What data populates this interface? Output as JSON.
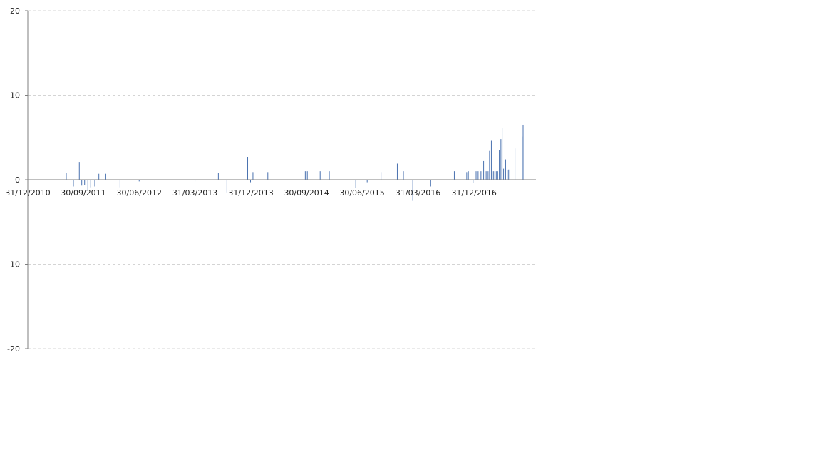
{
  "chart_data": {
    "type": "bar",
    "title": "",
    "xlabel": "",
    "ylabel": "",
    "ylim": [
      -20,
      20
    ],
    "xlim": [
      "2010-12-31",
      "2017-10-31"
    ],
    "grid": true,
    "yticks": [
      20,
      10,
      0,
      -10,
      -20
    ],
    "xticks": [
      {
        "label": "31/12/2010",
        "date": "2010-12-31"
      },
      {
        "label": "30/09/2011",
        "date": "2011-09-30"
      },
      {
        "label": "30/06/2012",
        "date": "2012-06-30"
      },
      {
        "label": "31/03/2013",
        "date": "2013-03-31"
      },
      {
        "label": "31/12/2013",
        "date": "2013-12-31"
      },
      {
        "label": "30/09/2014",
        "date": "2014-09-30"
      },
      {
        "label": "30/06/2015",
        "date": "2015-06-30"
      },
      {
        "label": "31/03/2016",
        "date": "2016-03-31"
      },
      {
        "label": "31/12/2016",
        "date": "2016-12-31"
      }
    ],
    "points": [
      {
        "date": "2011-07-08",
        "value": 0.8
      },
      {
        "date": "2011-08-12",
        "value": -0.8
      },
      {
        "date": "2011-09-10",
        "value": 2.1
      },
      {
        "date": "2011-09-22",
        "value": -0.7
      },
      {
        "date": "2011-10-06",
        "value": -0.6
      },
      {
        "date": "2011-10-22",
        "value": -1.2
      },
      {
        "date": "2011-11-05",
        "value": -0.9
      },
      {
        "date": "2011-11-25",
        "value": -0.8
      },
      {
        "date": "2011-12-15",
        "value": 0.7
      },
      {
        "date": "2012-01-18",
        "value": 0.7
      },
      {
        "date": "2012-03-28",
        "value": -0.9
      },
      {
        "date": "2012-06-30",
        "value": -0.2
      },
      {
        "date": "2013-03-31",
        "value": -0.2
      },
      {
        "date": "2013-07-24",
        "value": 0.8
      },
      {
        "date": "2013-09-04",
        "value": -1.5
      },
      {
        "date": "2013-12-15",
        "value": 2.7
      },
      {
        "date": "2013-12-29",
        "value": -0.3
      },
      {
        "date": "2014-01-10",
        "value": 0.9
      },
      {
        "date": "2014-03-24",
        "value": 0.9
      },
      {
        "date": "2014-09-24",
        "value": 1.0
      },
      {
        "date": "2014-10-04",
        "value": 1.0
      },
      {
        "date": "2014-12-06",
        "value": 1.0
      },
      {
        "date": "2015-01-20",
        "value": 1.0
      },
      {
        "date": "2015-05-30",
        "value": -1.0
      },
      {
        "date": "2015-07-25",
        "value": -0.3
      },
      {
        "date": "2015-10-01",
        "value": 0.9
      },
      {
        "date": "2015-12-20",
        "value": 1.9
      },
      {
        "date": "2016-01-19",
        "value": 1.0
      },
      {
        "date": "2016-03-05",
        "value": -2.5
      },
      {
        "date": "2016-06-01",
        "value": -0.8
      },
      {
        "date": "2016-09-25",
        "value": 1.0
      },
      {
        "date": "2016-11-25",
        "value": 0.9
      },
      {
        "date": "2016-12-03",
        "value": 1.0
      },
      {
        "date": "2016-12-26",
        "value": -0.4
      },
      {
        "date": "2017-01-10",
        "value": 1.0
      },
      {
        "date": "2017-01-20",
        "value": 1.0
      },
      {
        "date": "2017-02-03",
        "value": 1.0
      },
      {
        "date": "2017-02-16",
        "value": 2.2
      },
      {
        "date": "2017-02-24",
        "value": 1.0
      },
      {
        "date": "2017-03-03",
        "value": 1.0
      },
      {
        "date": "2017-03-10",
        "value": 1.0
      },
      {
        "date": "2017-03-17",
        "value": 3.4
      },
      {
        "date": "2017-03-26",
        "value": 4.6
      },
      {
        "date": "2017-04-05",
        "value": 1.0
      },
      {
        "date": "2017-04-12",
        "value": 1.0
      },
      {
        "date": "2017-04-19",
        "value": 1.0
      },
      {
        "date": "2017-04-26",
        "value": 1.0
      },
      {
        "date": "2017-05-04",
        "value": 3.5
      },
      {
        "date": "2017-05-12",
        "value": 4.8
      },
      {
        "date": "2017-05-18",
        "value": 6.1
      },
      {
        "date": "2017-05-25",
        "value": 1.3
      },
      {
        "date": "2017-06-04",
        "value": 2.4
      },
      {
        "date": "2017-06-12",
        "value": 1.1
      },
      {
        "date": "2017-06-19",
        "value": 1.2
      },
      {
        "date": "2017-07-20",
        "value": 3.7
      },
      {
        "date": "2017-08-24",
        "value": 5.1
      },
      {
        "date": "2017-08-29",
        "value": 6.5
      }
    ]
  },
  "colors": {
    "bar": "#4a72b0",
    "axis": "#7f7f7f",
    "grid": "#d4d4d4",
    "background": "#ffffff"
  }
}
